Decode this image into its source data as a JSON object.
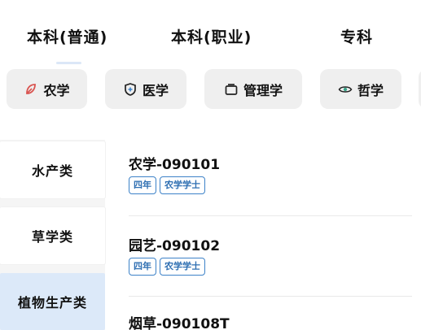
{
  "tabs": [
    {
      "label": "本科(普通)"
    },
    {
      "label": "本科(职业)"
    },
    {
      "label": "专科"
    }
  ],
  "categories": [
    {
      "label": "农学",
      "icon": "leaf-icon"
    },
    {
      "label": "医学",
      "icon": "shield-plus-icon"
    },
    {
      "label": "管理学",
      "icon": "folder-icon"
    },
    {
      "label": "哲学",
      "icon": "eye-icon"
    }
  ],
  "sidebar": {
    "items": [
      {
        "label": "水产类"
      },
      {
        "label": "草学类"
      },
      {
        "label": "植物生产类",
        "selected": true
      }
    ]
  },
  "majors": [
    {
      "name": "农学-090101",
      "tags": [
        "四年",
        "农学学士"
      ]
    },
    {
      "name": "园艺-090102",
      "tags": [
        "四年",
        "农学学士"
      ]
    },
    {
      "name": "烟草-090108T",
      "tags": []
    }
  ],
  "colors": {
    "chip_bg": "#efefef",
    "selected_bg": "#dce9f9",
    "tag_border": "#3d82c8",
    "tag_text": "#2f6fb2"
  }
}
